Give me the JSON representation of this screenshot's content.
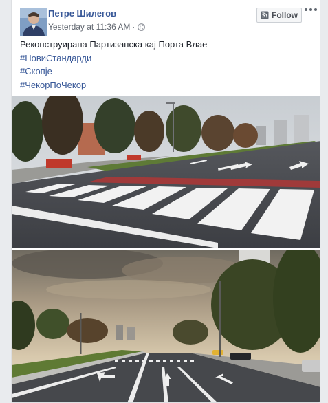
{
  "post": {
    "author": "Петре Шилегов",
    "timestamp": "Yesterday at 11:36 AM",
    "separator": "·",
    "privacy_icon": "globe-icon",
    "follow_label": "Follow",
    "more_icon": "more-options-icon",
    "text": "Реконструирана Партизанска кај Порта Влае",
    "hashtags": [
      "#НовиСтандарди",
      "#Скопје",
      "#ЧекорПоЧекор"
    ],
    "photos": [
      {
        "icon": "photo-crosswalk-street"
      },
      {
        "icon": "photo-boulevard-arrows"
      }
    ]
  },
  "colors": {
    "link": "#385898",
    "background": "#e9ebee",
    "text": "#1d2129",
    "meta": "#616770"
  }
}
